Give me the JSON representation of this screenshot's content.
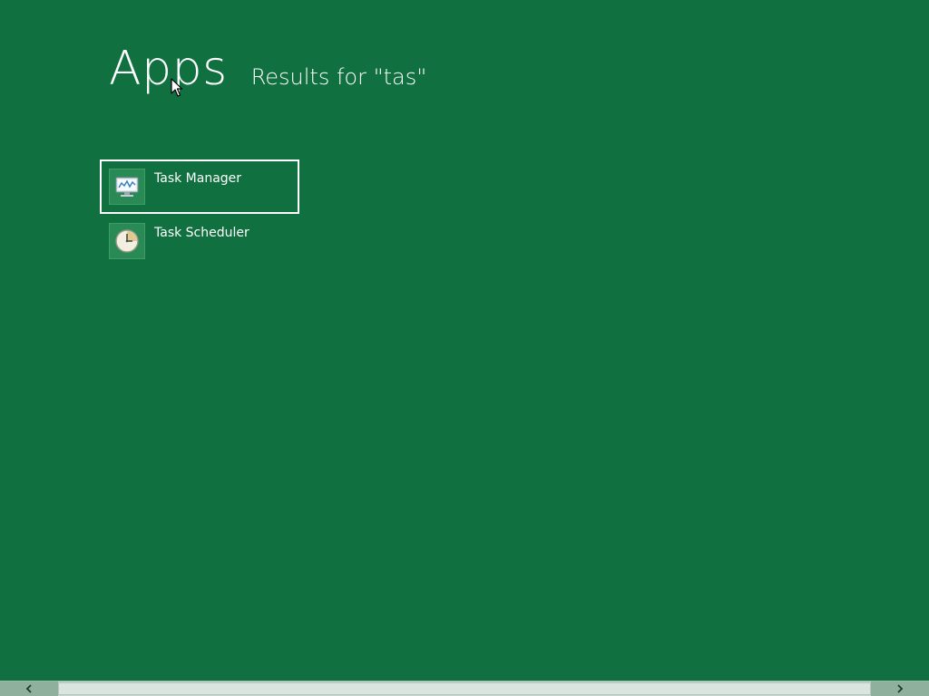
{
  "header": {
    "title": "Apps",
    "subtitle": "Results for \"tas\""
  },
  "results": [
    {
      "label": "Task Manager",
      "icon": "task-manager-icon",
      "selected": true
    },
    {
      "label": "Task Scheduler",
      "icon": "task-scheduler-icon",
      "selected": false
    }
  ],
  "scrollbar": {
    "left_icon": "chevron-left-icon",
    "right_icon": "chevron-right-icon"
  },
  "colors": {
    "background": "#107040",
    "text": "#ffffff",
    "tile_icon_bg": "#2a8a56",
    "selection_border": "#ffffff",
    "scrollbar_track": "#c7d6cc"
  }
}
